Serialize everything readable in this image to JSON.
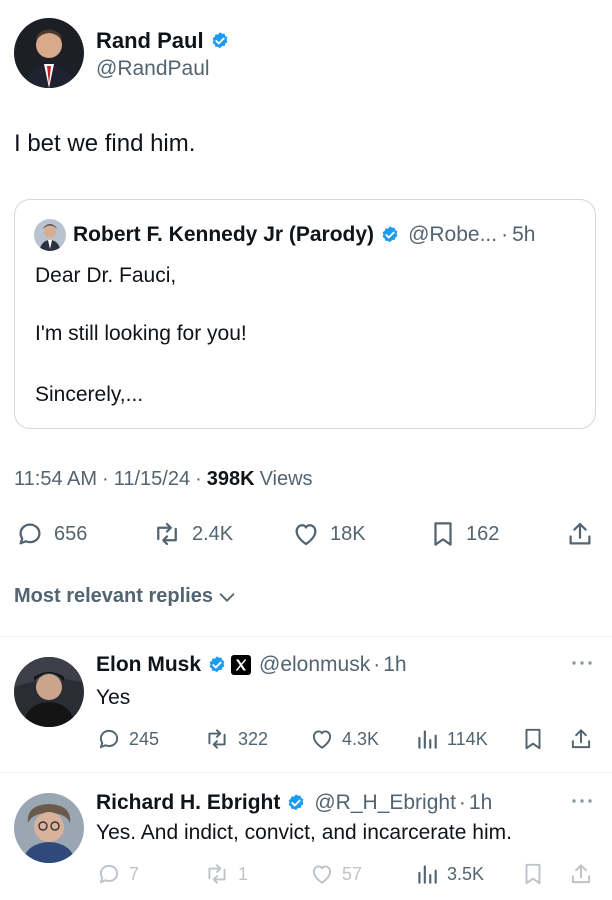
{
  "main_tweet": {
    "author_name": "Rand Paul",
    "handle": "@RandPaul",
    "text": "I bet we find him."
  },
  "quoted_tweet": {
    "author_name": "Robert F. Kennedy Jr (Parody)",
    "handle": "@Robe...",
    "time": "5h",
    "lines": [
      "Dear Dr. Fauci,",
      "I'm still looking for you!",
      "Sincerely,..."
    ]
  },
  "meta": {
    "time": "11:54 AM",
    "date": "11/15/24",
    "views_count": "398K",
    "views_label": "Views"
  },
  "actions": {
    "replies": "656",
    "reposts": "2.4K",
    "likes": "18K",
    "bookmarks": "162"
  },
  "sort": {
    "label": "Most relevant replies"
  },
  "replies": [
    {
      "author_name": "Elon Musk",
      "handle": "@elonmusk",
      "time": "1h",
      "text": "Yes",
      "replies": "245",
      "reposts": "322",
      "likes": "4.3K",
      "views": "114K"
    },
    {
      "author_name": "Richard H. Ebright",
      "handle": "@R_H_Ebright",
      "time": "1h",
      "text": "Yes. And indict, convict, and incarcerate him.",
      "replies": "7",
      "reposts": "1",
      "likes": "57",
      "views": "3.5K"
    }
  ],
  "colors": {
    "verified_blue": "#1d9bf0",
    "text": "#0f1419",
    "muted": "#536471",
    "border": "#cfd9de"
  },
  "icons": [
    "verified-badge-icon",
    "x-logo-icon",
    "reply-icon",
    "repost-icon",
    "like-icon",
    "bookmark-icon",
    "share-icon",
    "views-icon",
    "more-icon",
    "chevron-down-icon"
  ]
}
